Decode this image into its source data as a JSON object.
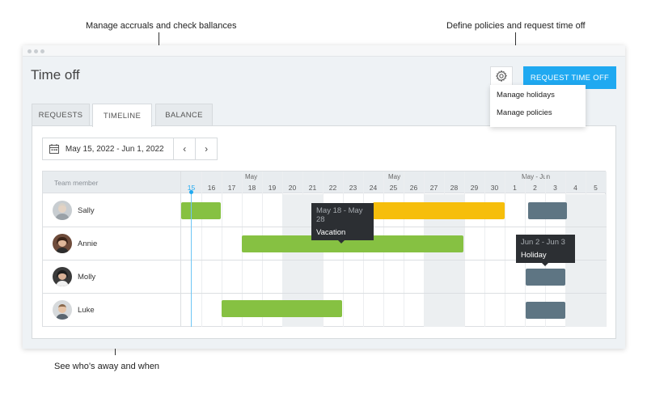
{
  "callouts": {
    "balances": "Manage accruals and check ballances",
    "policies": "Define policies and request time off",
    "away": "See who’s away and when"
  },
  "page": {
    "title": "Time off",
    "request_button": "REQUEST TIME OFF",
    "gear_icon": "gear-icon"
  },
  "dropdown": {
    "items": [
      "Manage holidays",
      "Manage policies"
    ]
  },
  "tabs": [
    {
      "label": "REQUESTS",
      "active": false
    },
    {
      "label": "TIMELINE",
      "active": true
    },
    {
      "label": "BALANCE",
      "active": false
    }
  ],
  "date_range": {
    "label": "May 15, 2022 - Jun 1, 2022",
    "prev": "‹",
    "next": "›"
  },
  "timeline": {
    "member_header": "Team member",
    "months": [
      "May",
      "May",
      "May - Jun"
    ],
    "days": [
      "15",
      "16",
      "17",
      "18",
      "19",
      "20",
      "21",
      "22",
      "23",
      "24",
      "25",
      "26",
      "27",
      "28",
      "29",
      "30",
      "1",
      "2",
      "3",
      "4",
      "5"
    ],
    "today": "15",
    "members": [
      {
        "name": "Sally"
      },
      {
        "name": "Annie"
      },
      {
        "name": "Molly"
      },
      {
        "name": "Luke"
      }
    ],
    "colors": {
      "green": "#86c142",
      "yellow": "#f6be0b",
      "slate": "#5e7583"
    },
    "tooltips": [
      {
        "date": "May 18 - May 28",
        "type": "Vacation"
      },
      {
        "date": "Jun 2 - Jun 3",
        "type": "Holiday"
      }
    ]
  }
}
